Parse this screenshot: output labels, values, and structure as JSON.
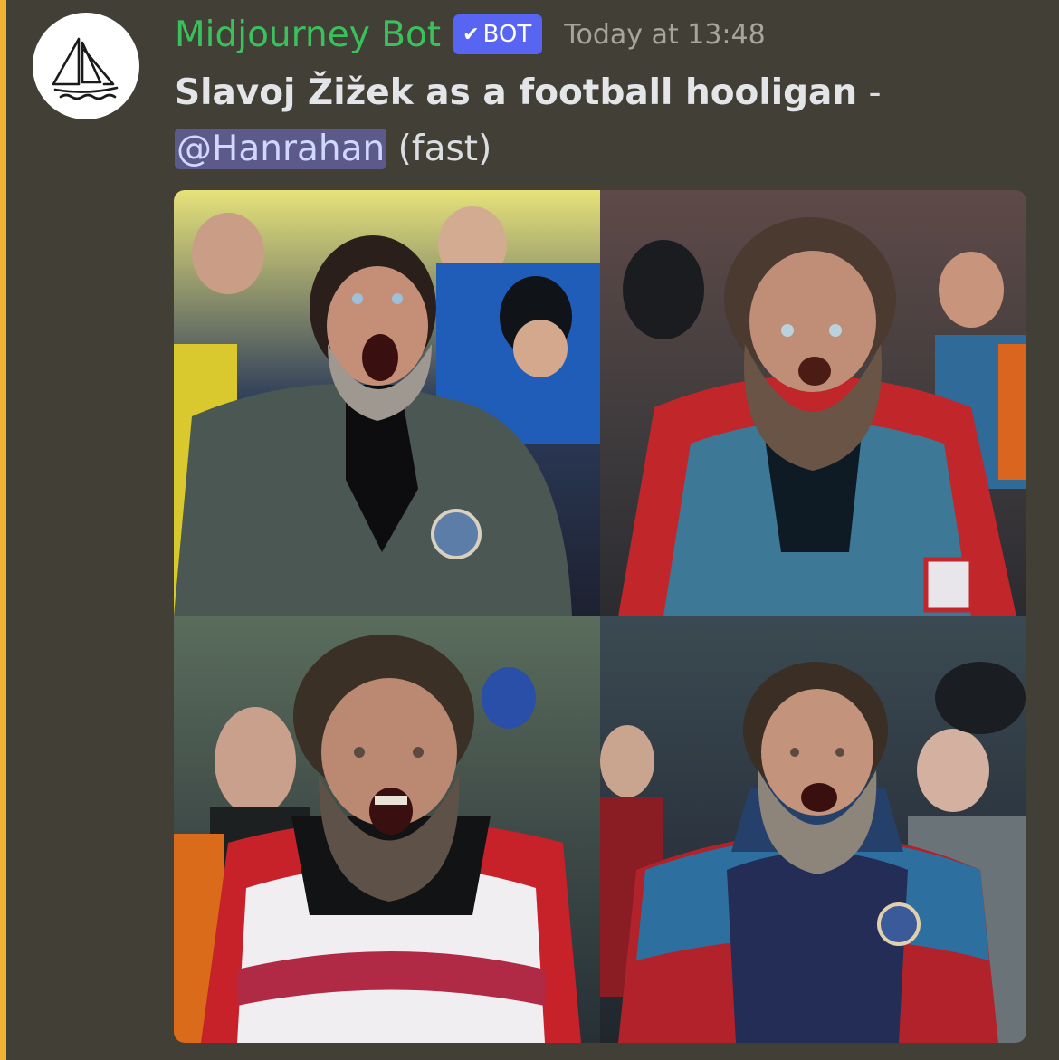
{
  "message": {
    "author": "Midjourney Bot",
    "bot_tag": "BOT",
    "bot_check": "✔",
    "timestamp": "Today at 13:48",
    "prompt": "Slavoj Žižek as a football hooligan",
    "separator": " - ",
    "mention": "@Hanrahan",
    "mode": "(fast)"
  },
  "avatar": {
    "icon": "sailboat-icon"
  },
  "colors": {
    "background": "#423f37",
    "highlight": "#f0b232",
    "username": "#3ac15b",
    "bot_tag": "#5865f2",
    "mention_bg": "#5b5a8a"
  },
  "images": [
    {
      "name": "generated-image-1",
      "subject": "shouting bearded man in grey jacket, yellow and blue crowd"
    },
    {
      "name": "generated-image-2",
      "subject": "bearded man in blue and red track jacket, crowd"
    },
    {
      "name": "generated-image-3",
      "subject": "bearded man in red and white track jacket, crowd"
    },
    {
      "name": "generated-image-4",
      "subject": "bearded man in navy and red track jacket, crowd"
    }
  ]
}
